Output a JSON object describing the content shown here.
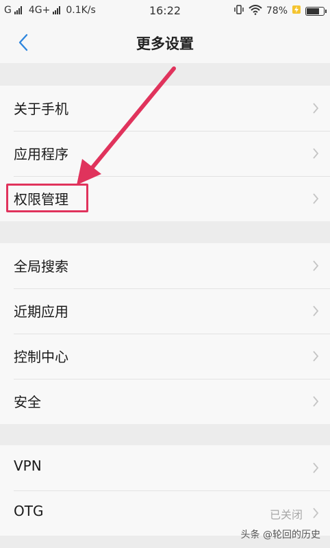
{
  "status_bar": {
    "carrier1": "G",
    "carrier2": "4G+",
    "speed": "0.1K/s",
    "time": "16:22",
    "battery_percent_text": "78%",
    "battery_level": 0.78
  },
  "header": {
    "title": "更多设置"
  },
  "sections": [
    {
      "items": [
        {
          "label": "关于手机",
          "value": ""
        },
        {
          "label": "应用程序",
          "value": ""
        },
        {
          "label": "权限管理",
          "value": ""
        }
      ]
    },
    {
      "items": [
        {
          "label": "全局搜索",
          "value": ""
        },
        {
          "label": "近期应用",
          "value": ""
        },
        {
          "label": "控制中心",
          "value": ""
        },
        {
          "label": "安全",
          "value": ""
        }
      ]
    },
    {
      "items": [
        {
          "label": "VPN",
          "value": ""
        },
        {
          "label": "OTG",
          "value": "已关闭"
        }
      ]
    }
  ],
  "watermark": "头条 @轮回的历史",
  "colors": {
    "accent": "#2e86de",
    "annotation": "#e0335c"
  }
}
